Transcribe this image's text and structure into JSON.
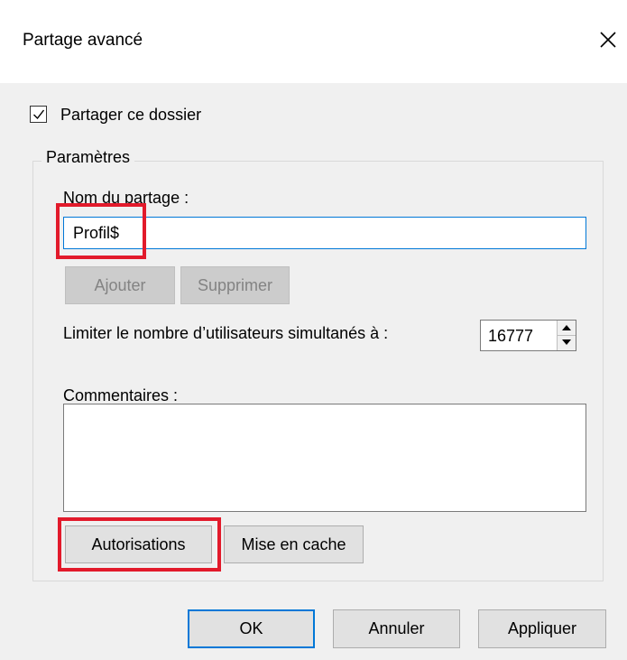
{
  "dialog": {
    "title": "Partage avancé"
  },
  "share": {
    "checkbox_label": "Partager ce dossier",
    "checked": true
  },
  "settings": {
    "group_label": "Paramètres",
    "name_label": "Nom du partage :",
    "name_value": "Profil$",
    "add_button": "Ajouter",
    "remove_button": "Supprimer",
    "limit_label": "Limiter le nombre d’utilisateurs simultanés à :",
    "limit_value": "16777",
    "comments_label": "Commentaires :",
    "comments_value": "",
    "permissions_button": "Autorisations",
    "caching_button": "Mise en cache"
  },
  "footer": {
    "ok": "OK",
    "cancel": "Annuler",
    "apply": "Appliquer"
  },
  "icons": {
    "close": "close-icon",
    "checkbox": "checkmark-icon",
    "spin_up": "arrow-up-icon",
    "spin_down": "arrow-down-icon"
  },
  "colors": {
    "highlight": "#e21a2b",
    "focus_border": "#0078d7"
  }
}
